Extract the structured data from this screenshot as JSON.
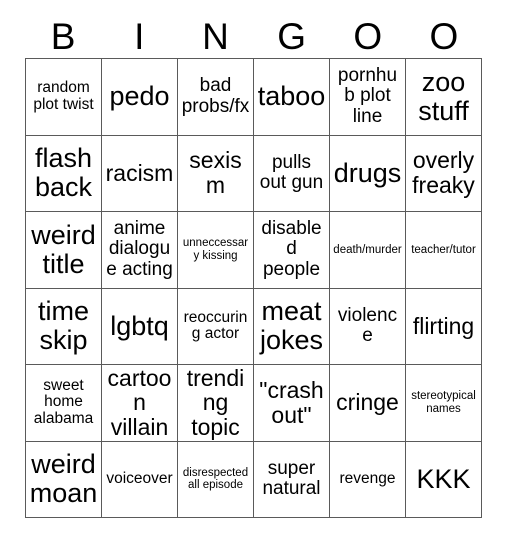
{
  "card": {
    "title": "BINGOO",
    "header_letters": [
      "B",
      "I",
      "N",
      "G",
      "O",
      "O"
    ],
    "columns": 6,
    "rows": 6,
    "border_color": "#5a5a5a",
    "background_color": "#ffffff",
    "text_color": "#000000",
    "cells": [
      [
        {
          "text": "random plot twist",
          "size": "s-sm"
        },
        {
          "text": "pedo",
          "size": "s-xl"
        },
        {
          "text": "bad probs/fx",
          "size": "s-md"
        },
        {
          "text": "taboo",
          "size": "s-xl"
        },
        {
          "text": "pornhub plot line",
          "size": "s-md"
        },
        {
          "text": "zoo stuff",
          "size": "s-xl"
        }
      ],
      [
        {
          "text": "flash back",
          "size": "s-xl"
        },
        {
          "text": "racism",
          "size": "s-lg"
        },
        {
          "text": "sexism",
          "size": "s-lg"
        },
        {
          "text": "pulls out gun",
          "size": "s-md"
        },
        {
          "text": "drugs",
          "size": "s-xl"
        },
        {
          "text": "overly freaky",
          "size": "s-lg"
        }
      ],
      [
        {
          "text": "weird title",
          "size": "s-xl"
        },
        {
          "text": "anime dialogue acting",
          "size": "s-md"
        },
        {
          "text": "unneccessary kissing",
          "size": "s-xs"
        },
        {
          "text": "disabled people",
          "size": "s-md"
        },
        {
          "text": "death/murder",
          "size": "s-xs"
        },
        {
          "text": "teacher/tutor",
          "size": "s-xs"
        }
      ],
      [
        {
          "text": "time skip",
          "size": "s-xl"
        },
        {
          "text": "lgbtq",
          "size": "s-xl"
        },
        {
          "text": "reoccuring actor",
          "size": "s-sm"
        },
        {
          "text": "meat jokes",
          "size": "s-xl"
        },
        {
          "text": "violence",
          "size": "s-md"
        },
        {
          "text": "flirting",
          "size": "s-lg"
        }
      ],
      [
        {
          "text": "sweet home alabama",
          "size": "s-sm"
        },
        {
          "text": "cartoon villain",
          "size": "s-lg"
        },
        {
          "text": "trending topic",
          "size": "s-lg"
        },
        {
          "text": "\"crash out\"",
          "size": "s-lg"
        },
        {
          "text": "cringe",
          "size": "s-lg"
        },
        {
          "text": "stereotypical names",
          "size": "s-xs"
        }
      ],
      [
        {
          "text": "weird moan",
          "size": "s-xl"
        },
        {
          "text": "voiceover",
          "size": "s-sm"
        },
        {
          "text": "disrespected all episode",
          "size": "s-xs"
        },
        {
          "text": "super natural",
          "size": "s-md"
        },
        {
          "text": "revenge",
          "size": "s-sm"
        },
        {
          "text": "KKK",
          "size": "s-xl"
        }
      ]
    ]
  }
}
